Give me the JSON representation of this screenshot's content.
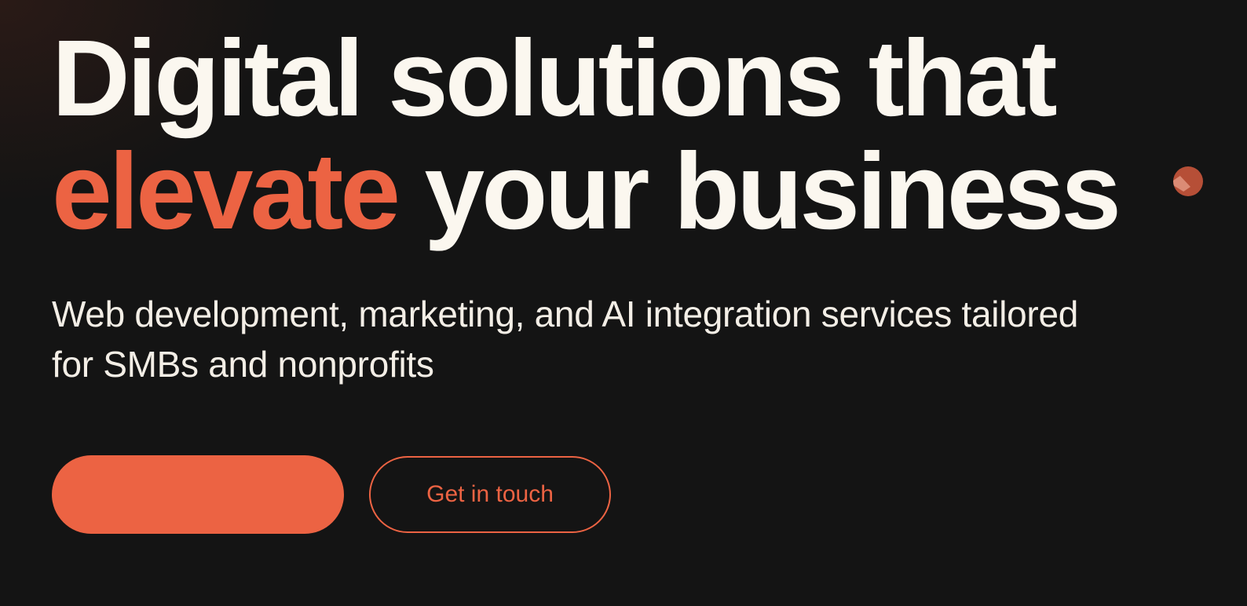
{
  "hero": {
    "headline_line1": "Digital solutions that",
    "headline_accent": "elevate",
    "headline_rest": " your business",
    "subtitle": "Web development, marketing, and AI integration services tailored for SMBs and nonprofits"
  },
  "cta": {
    "primary_label": "",
    "secondary_label": "Get in touch"
  },
  "colors": {
    "background": "#141414",
    "accent": "#ec6343",
    "text": "#fbf7ef"
  },
  "icons": {
    "cursor": "cursor-dot-icon"
  }
}
